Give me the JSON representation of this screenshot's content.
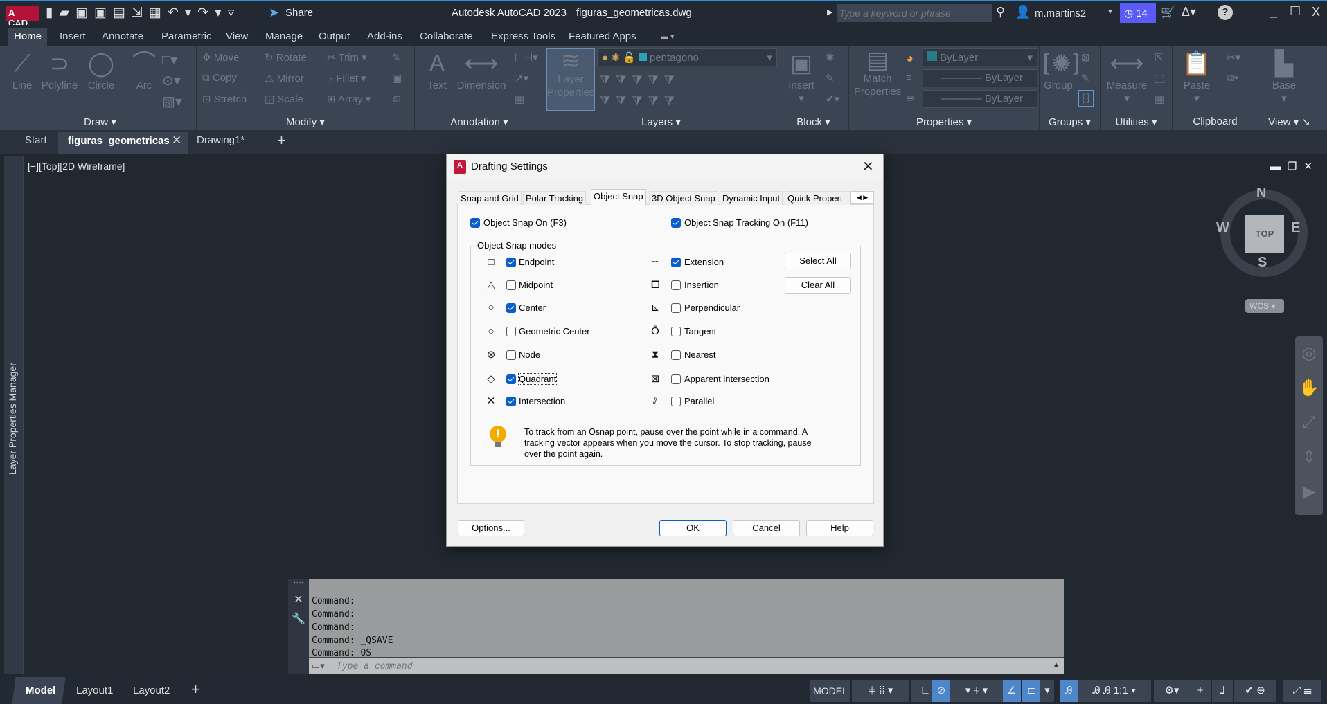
{
  "titlebar": {
    "app_badge": "A CAD",
    "share": "Share",
    "title": "Autodesk AutoCAD 2023",
    "file": "figuras_geometricas.dwg",
    "search_placeholder": "Type a keyword or phrase",
    "user": "m.martins2",
    "notifications": "14",
    "help": "?"
  },
  "ribbon_tabs": [
    "Home",
    "Insert",
    "Annotate",
    "Parametric",
    "View",
    "Manage",
    "Output",
    "Add-ins",
    "Collaborate",
    "Express Tools",
    "Featured Apps"
  ],
  "ribbon": {
    "draw": {
      "title": "Draw",
      "line": "Line",
      "polyline": "Polyline",
      "circle": "Circle",
      "arc": "Arc"
    },
    "modify": {
      "title": "Modify",
      "move": "Move",
      "rotate": "Rotate",
      "trim": "Trim",
      "copy": "Copy",
      "mirror": "Mirror",
      "fillet": "Fillet",
      "stretch": "Stretch",
      "scale": "Scale",
      "array": "Array"
    },
    "annotation": {
      "title": "Annotation",
      "text": "Text",
      "dimension": "Dimension"
    },
    "layers": {
      "title": "Layers",
      "layer_properties_1": "Layer",
      "layer_properties_2": "Properties",
      "current_layer": "pentagono"
    },
    "block": {
      "title": "Block",
      "insert": "Insert"
    },
    "properties": {
      "title": "Properties",
      "match_1": "Match",
      "match_2": "Properties",
      "color": "ByLayer",
      "linetype": "ByLayer",
      "lineweight": "ByLayer"
    },
    "groups": {
      "title": "Groups",
      "group": "Group"
    },
    "utilities": {
      "title": "Utilities",
      "measure": "Measure"
    },
    "clipboard": {
      "title": "Clipboard",
      "paste": "Paste"
    },
    "view": {
      "title": "View",
      "base": "Base"
    }
  },
  "file_tabs": {
    "start": "Start",
    "active": "figuras_geometricas",
    "drawing": "Drawing1*",
    "add": "+"
  },
  "viewport": {
    "label": "[−][Top][2D Wireframe]",
    "viewcube": {
      "n": "N",
      "s": "S",
      "e": "E",
      "w": "W",
      "face": "TOP",
      "ucs": "WCS"
    }
  },
  "palette": {
    "layer_properties_manager": "Layer Properties Manager"
  },
  "dialog": {
    "title": "Drafting Settings",
    "tabs": [
      "Snap and Grid",
      "Polar Tracking",
      "Object Snap",
      "3D Object Snap",
      "Dynamic Input",
      "Quick Propert"
    ],
    "active_tab": "Object Snap",
    "osnap_on": {
      "label": "Object Snap On (F3)",
      "checked": true
    },
    "tracking_on": {
      "label": "Object Snap Tracking On (F11)",
      "checked": true
    },
    "modes_title": "Object Snap modes",
    "left_modes": [
      {
        "label": "Endpoint",
        "checked": true,
        "icon": "square-marker"
      },
      {
        "label": "Midpoint",
        "checked": false,
        "icon": "triangle-marker"
      },
      {
        "label": "Center",
        "checked": true,
        "icon": "circle-marker"
      },
      {
        "label": "Geometric Center",
        "checked": false,
        "icon": "circle-marker"
      },
      {
        "label": "Node",
        "checked": false,
        "icon": "node-marker"
      },
      {
        "label": "Quadrant",
        "checked": true,
        "icon": "diamond-marker"
      },
      {
        "label": "Intersection",
        "checked": true,
        "icon": "x-marker"
      }
    ],
    "right_modes": [
      {
        "label": "Extension",
        "checked": true,
        "icon": "extension-marker"
      },
      {
        "label": "Insertion",
        "checked": false,
        "icon": "insertion-marker"
      },
      {
        "label": "Perpendicular",
        "checked": false,
        "icon": "perpendicular-marker"
      },
      {
        "label": "Tangent",
        "checked": false,
        "icon": "tangent-marker"
      },
      {
        "label": "Nearest",
        "checked": false,
        "icon": "hourglass-marker"
      },
      {
        "label": "Apparent intersection",
        "checked": false,
        "icon": "boxed-x-marker"
      },
      {
        "label": "Parallel",
        "checked": false,
        "icon": "parallel-marker"
      }
    ],
    "select_all": "Select All",
    "clear_all": "Clear All",
    "tip": "To track from an Osnap point, pause over the point while in a command.  A tracking vector appears when you move the cursor.  To stop tracking, pause over the point again.",
    "options": "Options...",
    "ok": "OK",
    "cancel": "Cancel",
    "help": "Help"
  },
  "command": {
    "history": [
      "Command:",
      "Command:",
      "Command:",
      "Command:  _QSAVE",
      "Command:  OS"
    ],
    "placeholder": "Type a command"
  },
  "layout_tabs": [
    "Model",
    "Layout1",
    "Layout2",
    "+"
  ],
  "status": {
    "model": "MODEL",
    "scale": "1:1"
  },
  "colors": {
    "accent": "#2d8fd6",
    "ribbon": "#3b4453",
    "background": "#212830",
    "checkbox": "#0b5ec9",
    "notification": "#5b5bf5"
  }
}
